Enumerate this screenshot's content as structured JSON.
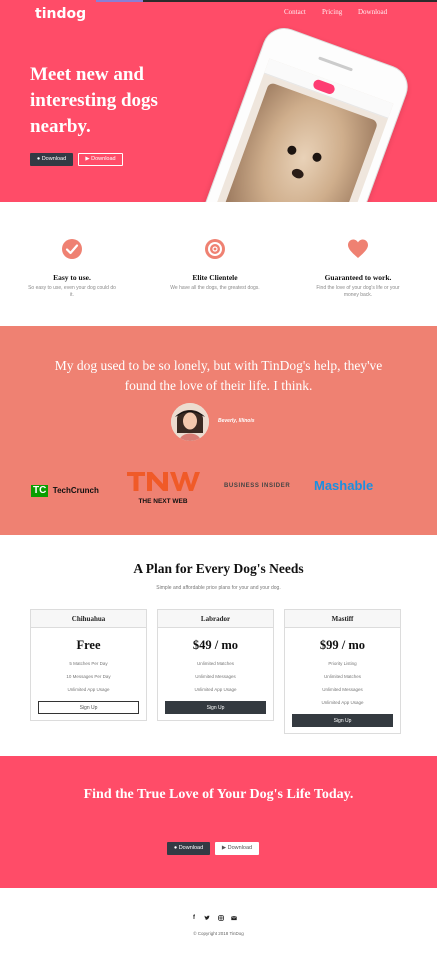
{
  "colors": {
    "brand_red": "#ff4c68",
    "salmon": "#ef8172",
    "dark": "#343a40"
  },
  "navbar": {
    "brand": "tindog",
    "links": [
      "Contact",
      "Pricing",
      "Download"
    ]
  },
  "hero": {
    "heading": "Meet new and interesting dogs nearby.",
    "download_buttons": [
      {
        "label": "Download",
        "icon": "apple-icon"
      },
      {
        "label": "Download",
        "icon": "play-store-icon"
      }
    ]
  },
  "features": [
    {
      "icon": "check-circle-icon",
      "title": "Easy to use.",
      "text": "So easy to use, even your dog could do it."
    },
    {
      "icon": "bullseye-icon",
      "title": "Elite Clientele",
      "text": "We have all the dogs, the greatest dogs."
    },
    {
      "icon": "heart-icon",
      "title": "Guaranteed to work.",
      "text": "Find the love of your dog's life or your money back."
    }
  ],
  "testimonial": {
    "quote": "My dog used to be so lonely, but with TinDog's help, they've found the love of their life. I think.",
    "author": "Beverly, Illinois"
  },
  "press_logos": [
    {
      "name": "tc-logo",
      "text": "TechCrunch"
    },
    {
      "name": "tnw-logo",
      "text": "THE NEXT WEB"
    },
    {
      "name": "business-insider-logo",
      "text": "BUSINESS INSIDER"
    },
    {
      "name": "mashable-logo",
      "text": "Mashable"
    }
  ],
  "pricing": {
    "title": "A Plan for Every Dog's Needs",
    "subtitle": "Simple and affordable price plans for your and your dog.",
    "plans": [
      {
        "name": "Chihuahua",
        "price": "Free",
        "features": [
          "5 Matches Per Day",
          "10 Messages Per Day",
          "Unlimited App Usage"
        ],
        "button": "Sign Up"
      },
      {
        "name": "Labrador",
        "price": "$49 / mo",
        "features": [
          "Unlimited Matches",
          "Unlimited Messages",
          "Unlimited App Usage"
        ],
        "button": "Sign Up"
      },
      {
        "name": "Mastiff",
        "price": "$99 / mo",
        "features": [
          "Priority Listing",
          "Unlimited Matches",
          "Unlimited Messages",
          "Unlimited App Usage"
        ],
        "button": "Sign Up"
      }
    ]
  },
  "cta": {
    "heading": "Find the True Love of Your Dog's Life Today.",
    "download_buttons": [
      {
        "label": "Download",
        "icon": "apple-icon"
      },
      {
        "label": "Download",
        "icon": "play-store-icon"
      }
    ]
  },
  "footer": {
    "social_icons": [
      "facebook-icon",
      "twitter-icon",
      "instagram-icon",
      "email-icon"
    ],
    "copyright": "© Copyright 2018 TinDog"
  }
}
